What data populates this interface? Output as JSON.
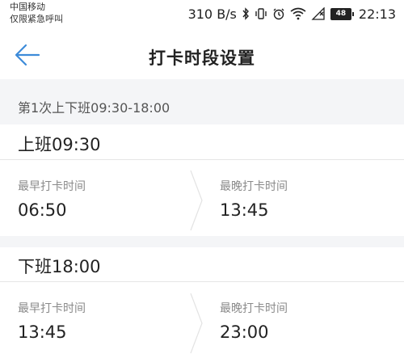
{
  "status_bar": {
    "carrier_line1": "中国移动",
    "carrier_line2": "仅限紧急呼叫",
    "net_speed": "310 B/s",
    "battery": "48",
    "time": "22:13"
  },
  "header": {
    "title": "打卡时段设置"
  },
  "schedule": {
    "section_label": "第1次上下班09:30-18:00",
    "shifts": [
      {
        "title": "上班09:30",
        "earliest_label": "最早打卡时间",
        "earliest_value": "06:50",
        "latest_label": "最晚打卡时间",
        "latest_value": "13:45"
      },
      {
        "title": "下班18:00",
        "earliest_label": "最早打卡时间",
        "earliest_value": "13:45",
        "latest_label": "最晚打卡时间",
        "latest_value": "23:00"
      }
    ]
  },
  "colors": {
    "accent": "#3d8bd9",
    "band": "#f4f5f7"
  }
}
